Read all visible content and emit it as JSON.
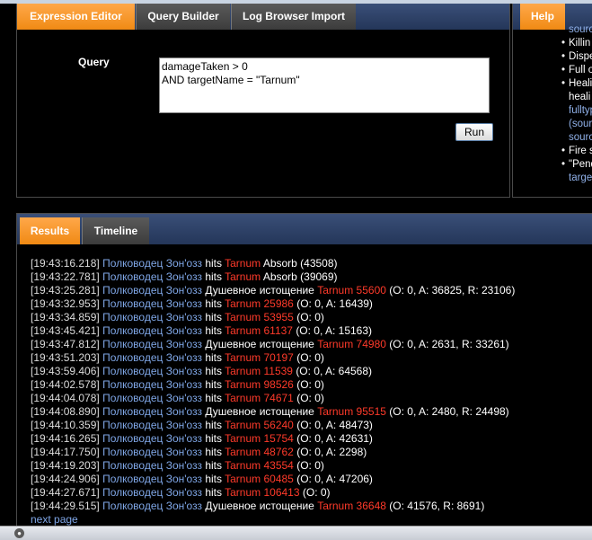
{
  "query_panel": {
    "tabs": [
      {
        "label": "Expression Editor",
        "active": true
      },
      {
        "label": "Query Builder",
        "active": false
      },
      {
        "label": "Log Browser Import",
        "active": false
      }
    ],
    "query_label": "Query",
    "query_value": "damageTaken > 0\nAND targetName = \"Tarnum\"",
    "run_label": "Run"
  },
  "help_panel": {
    "tab_label": "Help",
    "items": [
      {
        "text": "sourc",
        "kind": "link-indent"
      },
      {
        "text": "Killin",
        "kind": "bullet"
      },
      {
        "text": "Dispe",
        "kind": "bullet"
      },
      {
        "text": "Full o",
        "kind": "bullet"
      },
      {
        "text": "Heali",
        "kind": "bullet"
      },
      {
        "text": "heali",
        "kind": "indent"
      },
      {
        "text": "fulltyp",
        "kind": "link-indent"
      },
      {
        "text": "(sour",
        "kind": "link-indent"
      },
      {
        "text": "sourc",
        "kind": "link-indent"
      },
      {
        "text": "Fire s",
        "kind": "bullet"
      },
      {
        "text": "\"Pend",
        "kind": "bullet"
      },
      {
        "text": "targe",
        "kind": "link-indent"
      }
    ]
  },
  "results_panel": {
    "tabs": [
      {
        "label": "Results",
        "active": true
      },
      {
        "label": "Timeline",
        "active": false
      }
    ],
    "rows": [
      {
        "ts": "[19:43:16.218]",
        "src": "Полководец Зон'озз",
        "verb": "hits",
        "tgt": "Tarnum",
        "dmg": "",
        "detail": "Absorb (43508)"
      },
      {
        "ts": "[19:43:22.781]",
        "src": "Полководец Зон'озз",
        "verb": "hits",
        "tgt": "Tarnum",
        "dmg": "",
        "detail": "Absorb (39069)"
      },
      {
        "ts": "[19:43:25.281]",
        "src": "Полководец Зон'озз",
        "verb": "Душевное истощение",
        "tgt": "Tarnum",
        "dmg": "55600",
        "detail": "(O: 0, A: 36825, R: 23106)"
      },
      {
        "ts": "[19:43:32.953]",
        "src": "Полководец Зон'озз",
        "verb": "hits",
        "tgt": "Tarnum",
        "dmg": "25986",
        "detail": "(O: 0, A: 16439)"
      },
      {
        "ts": "[19:43:34.859]",
        "src": "Полководец Зон'озз",
        "verb": "hits",
        "tgt": "Tarnum",
        "dmg": "53955",
        "detail": "(O: 0)"
      },
      {
        "ts": "[19:43:45.421]",
        "src": "Полководец Зон'озз",
        "verb": "hits",
        "tgt": "Tarnum",
        "dmg": "61137",
        "detail": "(O: 0, A: 15163)"
      },
      {
        "ts": "[19:43:47.812]",
        "src": "Полководец Зон'озз",
        "verb": "Душевное истощение",
        "tgt": "Tarnum",
        "dmg": "74980",
        "detail": "(O: 0, A: 2631, R: 33261)"
      },
      {
        "ts": "[19:43:51.203]",
        "src": "Полководец Зон'озз",
        "verb": "hits",
        "tgt": "Tarnum",
        "dmg": "70197",
        "detail": "(O: 0)"
      },
      {
        "ts": "[19:43:59.406]",
        "src": "Полководец Зон'озз",
        "verb": "hits",
        "tgt": "Tarnum",
        "dmg": "11539",
        "detail": "(O: 0, A: 64568)"
      },
      {
        "ts": "[19:44:02.578]",
        "src": "Полководец Зон'озз",
        "verb": "hits",
        "tgt": "Tarnum",
        "dmg": "98526",
        "detail": "(O: 0)"
      },
      {
        "ts": "[19:44:04.078]",
        "src": "Полководец Зон'озз",
        "verb": "hits",
        "tgt": "Tarnum",
        "dmg": "74671",
        "detail": "(O: 0)"
      },
      {
        "ts": "[19:44:08.890]",
        "src": "Полководец Зон'озз",
        "verb": "Душевное истощение",
        "tgt": "Tarnum",
        "dmg": "95515",
        "detail": "(O: 0, A: 2480, R: 24498)"
      },
      {
        "ts": "[19:44:10.359]",
        "src": "Полководец Зон'озз",
        "verb": "hits",
        "tgt": "Tarnum",
        "dmg": "56240",
        "detail": "(O: 0, A: 48473)"
      },
      {
        "ts": "[19:44:16.265]",
        "src": "Полководец Зон'озз",
        "verb": "hits",
        "tgt": "Tarnum",
        "dmg": "15754",
        "detail": "(O: 0, A: 42631)"
      },
      {
        "ts": "[19:44:17.750]",
        "src": "Полководец Зон'озз",
        "verb": "hits",
        "tgt": "Tarnum",
        "dmg": "48762",
        "detail": "(O: 0, A: 2298)"
      },
      {
        "ts": "[19:44:19.203]",
        "src": "Полководец Зон'озз",
        "verb": "hits",
        "tgt": "Tarnum",
        "dmg": "43554",
        "detail": "(O: 0)"
      },
      {
        "ts": "[19:44:24.906]",
        "src": "Полководец Зон'озз",
        "verb": "hits",
        "tgt": "Tarnum",
        "dmg": "60485",
        "detail": "(O: 0, A: 47206)"
      },
      {
        "ts": "[19:44:27.671]",
        "src": "Полководец Зон'озз",
        "verb": "hits",
        "tgt": "Tarnum",
        "dmg": "106413",
        "detail": "(O: 0)"
      },
      {
        "ts": "[19:44:29.515]",
        "src": "Полководец Зон'озз",
        "verb": "Душевное истощение",
        "tgt": "Tarnum",
        "dmg": "36648",
        "detail": "(O: 41576, R: 8691)"
      }
    ],
    "next_page": "next page"
  },
  "colors": {
    "tab_active": "#f08a14",
    "source_name": "#7fa6e6",
    "target_name": "#ff3a2a",
    "background": "#000000"
  },
  "icons": {
    "status": "globe-icon"
  }
}
